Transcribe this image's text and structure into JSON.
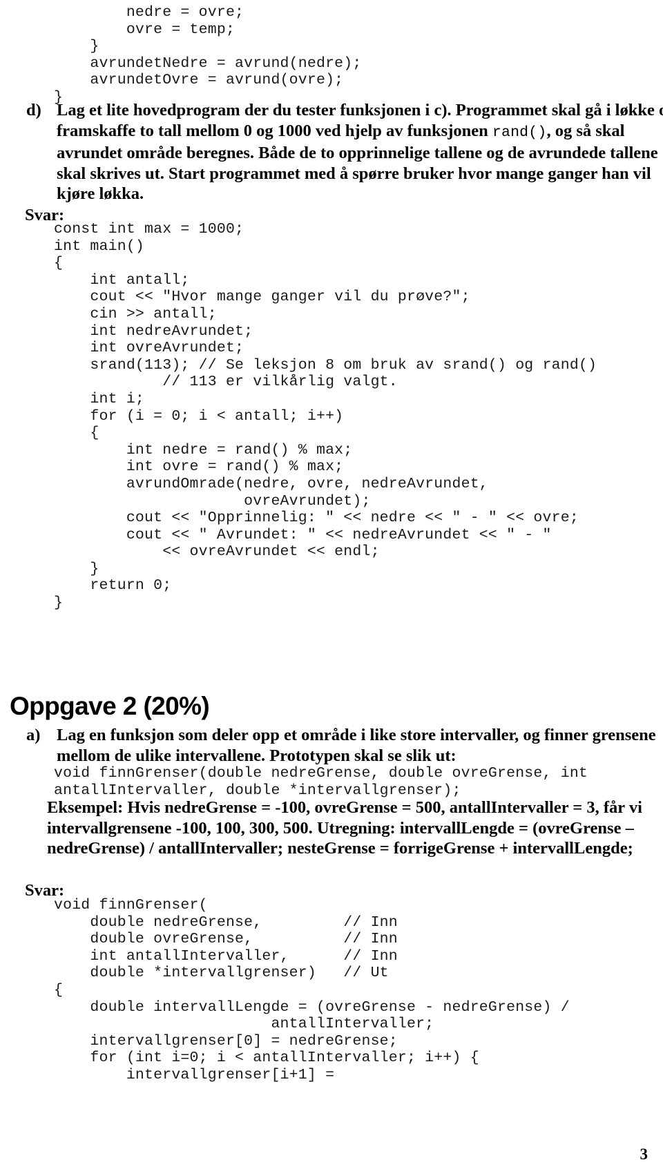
{
  "document": {
    "page_number": "3",
    "language": "no"
  },
  "code_top": "        nedre = ovre;\n        ovre = temp;\n    }\n    avrundetNedre = avrund(nedre);\n    avrundetOvre = avrund(ovre);\n}",
  "task_d": {
    "marker": "d)",
    "text_part1": "Lag et lite hovedprogram der du tester funksjonen i c). Programmet skal gå i løkke og framskaffe to tall mellom 0 og 1000 ved hjelp av funksjonen ",
    "mono_inline": "rand()",
    "text_part2": ", og så skal avrundet område beregnes. Både de to opprinnelige tallene og de avrundede tallene skal skrives ut. Start programmet med å spørre bruker hvor mange ganger han vil kjøre løkka."
  },
  "svar_label_1": "Svar:",
  "code_main": "const int max = 1000;\nint main()\n{\n    int antall;\n    cout << \"Hvor mange ganger vil du prøve?\";\n    cin >> antall;\n    int nedreAvrundet;\n    int ovreAvrundet;\n    srand(113); // Se leksjon 8 om bruk av srand() og rand()\n            // 113 er vilkårlig valgt.\n    int i;\n    for (i = 0; i < antall; i++)\n    {\n        int nedre = rand() % max;\n        int ovre = rand() % max;\n        avrundOmrade(nedre, ovre, nedreAvrundet,\n                     ovreAvrundet);\n        cout << \"Opprinnelig: \" << nedre << \" - \" << ovre;\n        cout << \" Avrundet: \" << nedreAvrundet << \" - \"\n            << ovreAvrundet << endl;\n    }\n    return 0;\n}",
  "heading_oppgave2": "Oppgave 2 (20%)",
  "task_a": {
    "marker": "a)",
    "text": "Lag en funksjon som deler opp et område i like store intervaller, og finner grensene mellom de ulike intervallene. Prototypen skal se slik ut:"
  },
  "prototype_code": "void finnGrenser(double nedreGrense, double ovreGrense, int\nantallIntervaller, double *intervallgrenser);",
  "example_text": "Eksempel: Hvis nedreGrense = -100, ovreGrense = 500, antallIntervaller = 3, får vi intervallgrensene -100, 100, 300, 500. Utregning: intervallLengde = (ovreGrense – nedreGrense) / antallIntervaller; nesteGrense = forrigeGrense + intervallLengde;",
  "svar_label_2": "Svar:",
  "code_bottom": "void finnGrenser(\n    double nedreGrense,         // Inn\n    double ovreGrense,          // Inn\n    int antallIntervaller,      // Inn\n    double *intervallgrenser)   // Ut\n{\n    double intervallLengde = (ovreGrense - nedreGrense) /\n                        antallIntervaller;\n    intervallgrenser[0] = nedreGrense;\n    for (int i=0; i < antallIntervaller; i++) {\n        intervallgrenser[i+1] ="
}
